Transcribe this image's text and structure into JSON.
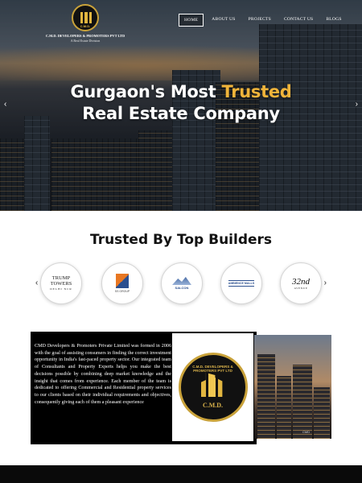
{
  "header": {
    "logo": {
      "badge_text": "C.M.D.",
      "company_name": "C.M.D. DEVELOPERS & PROMOTERS PVT LTD",
      "tagline": "A Real Estate Division"
    },
    "nav": [
      {
        "label": "HOME",
        "active": true
      },
      {
        "label": "ABOUT US",
        "active": false
      },
      {
        "label": "PROJECTS",
        "active": false
      },
      {
        "label": "CONTACT US",
        "active": false
      },
      {
        "label": "BLOGS",
        "active": false
      }
    ]
  },
  "hero": {
    "title_part1": "Gurgaon's Most ",
    "title_accent": "Trusted",
    "title_line2": "Real Estate Company",
    "prev_arrow": "‹",
    "next_arrow": "›"
  },
  "builders": {
    "heading": "Trusted By Top Builders",
    "prev_arrow": "‹",
    "next_arrow": "›",
    "logos": [
      {
        "name": "trump-towers",
        "line1": "TRUMP",
        "line2": "TOWERS",
        "line3": "DELHI NCR"
      },
      {
        "name": "ss-group",
        "text": "SS GROUP"
      },
      {
        "name": "salcon",
        "text": "SALCON"
      },
      {
        "name": "ambience",
        "text": "AMBIENCE MALLS"
      },
      {
        "name": "32nd-avenue",
        "line1": "32nd",
        "line2": "AVENUE"
      }
    ]
  },
  "about": {
    "text": "CMD Developers & Promoters Private Limited was formed in 2006 with the goal of assisting consumers in finding the correct investment opportunity in India's fast-paced property sector. Our integrated team of Consultants and Property Experts helps you make the best decisions possible by combining deep market knowledge and the insight that comes from experience. Each member of the team is dedicated to offering Commercial and Residential property services to our clients based on their individual requirements and objectives, consequently giving each of them a pleasant experience",
    "emblem_ring": "C.M.D. DEVELOPERS & PROMOTERS PVT LTD",
    "emblem_name": "C.M.D.",
    "photo_watermark": "CMD"
  },
  "colors": {
    "accent_gold": "#f0b43a",
    "dark_panel": "#000000",
    "heading": "#111111"
  }
}
